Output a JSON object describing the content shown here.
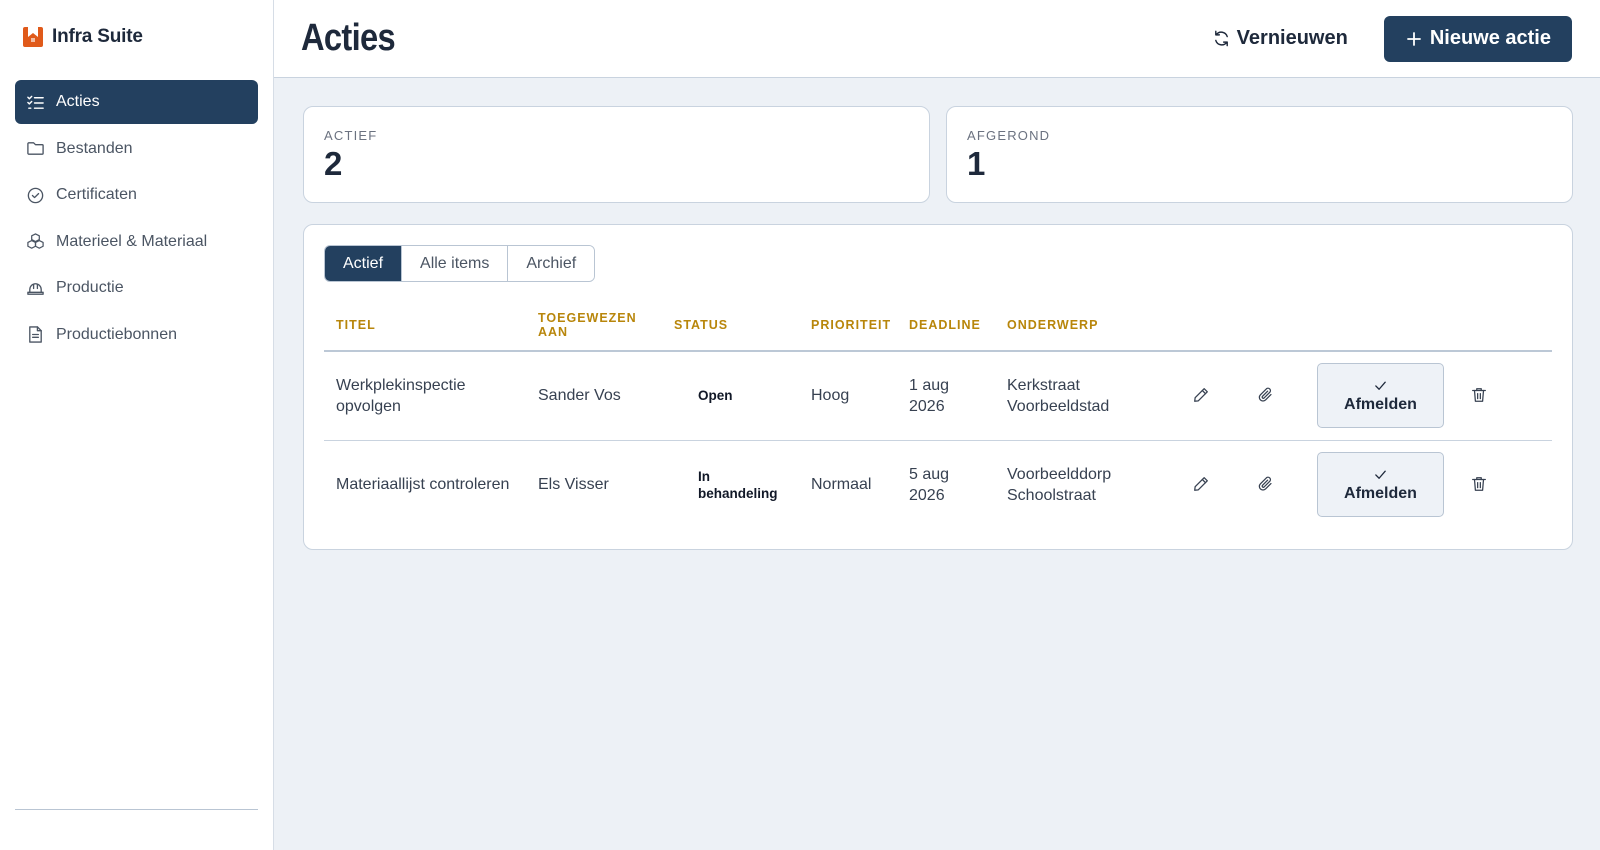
{
  "brand": {
    "name": "Infra Suite",
    "color": "#e05a1a"
  },
  "sidebar": {
    "items": [
      {
        "label": "Acties",
        "icon": "list-check-icon",
        "active": true
      },
      {
        "label": "Bestanden",
        "icon": "folder-icon",
        "active": false
      },
      {
        "label": "Certificaten",
        "icon": "badge-check-icon",
        "active": false
      },
      {
        "label": "Materieel & Materiaal",
        "icon": "boxes-icon",
        "active": false
      },
      {
        "label": "Productie",
        "icon": "hard-hat-icon",
        "active": false
      },
      {
        "label": "Productiebonnen",
        "icon": "document-icon",
        "active": false
      }
    ]
  },
  "header": {
    "title": "Acties",
    "refresh_label": "Vernieuwen",
    "new_label": "Nieuwe actie"
  },
  "stats": [
    {
      "label": "ACTIEF",
      "value": "2"
    },
    {
      "label": "AFGEROND",
      "value": "1"
    }
  ],
  "tabs": [
    {
      "label": "Actief",
      "active": true
    },
    {
      "label": "Alle items",
      "active": false
    },
    {
      "label": "Archief",
      "active": false
    }
  ],
  "table": {
    "columns": [
      "TITEL",
      "TOEGEWEZEN AAN",
      "STATUS",
      "PRIORITEIT",
      "DEADLINE",
      "ONDERWERP"
    ],
    "action_label": "Afmelden",
    "rows": [
      {
        "title": "Werkplekinspectie opvolgen",
        "assignee": "Sander Vos",
        "status": "Open",
        "priority": "Hoog",
        "deadline": "1 aug 2026",
        "subject": "Kerkstraat Voorbeeldstad"
      },
      {
        "title": "Materiaallijst controleren",
        "assignee": "Els Visser",
        "status": "In behandeling",
        "priority": "Normaal",
        "deadline": "5 aug 2026",
        "subject": "Voorbeelddorp Schoolstraat"
      }
    ]
  },
  "colors": {
    "primary": "#23405f",
    "accent_header": "#b8860b",
    "background": "#edf1f6"
  }
}
